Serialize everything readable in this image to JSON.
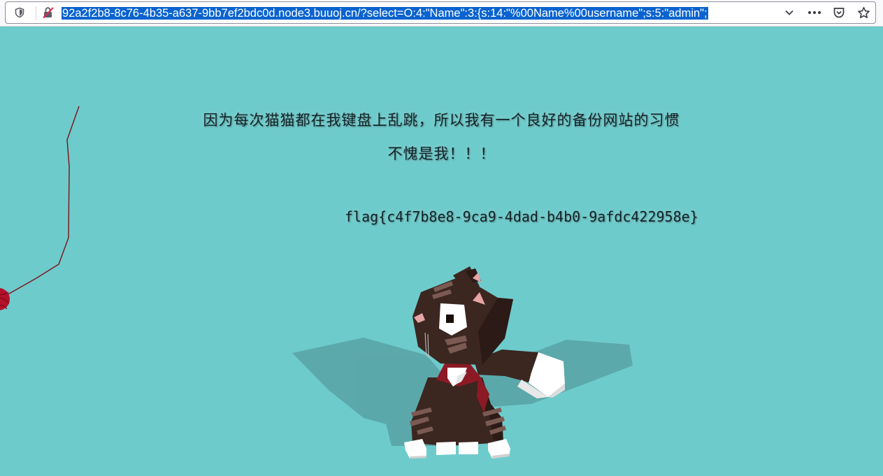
{
  "browser": {
    "url": "92a2f2b8-8c76-4b35-a637-9bb7ef2bdc0d.node3.buuoj.cn/?select=O:4:\"Name\":3:{s:14:\"%00Name%00username\";s:5:\"admin\";",
    "icons": [
      "shield-icon",
      "insecure-lock-icon",
      "chevron-down-icon",
      "more-icon",
      "pocket-icon",
      "bookmark-star-icon"
    ]
  },
  "page": {
    "message_line1": "因为每次猫猫都在我键盘上乱跳，所以我有一个良好的备份网站的习惯",
    "message_line2": "不愧是我！！！",
    "flag": "flag{c4f7b8e8-9ca9-4dad-b4b0-9afdc422958e}"
  },
  "colors": {
    "background": "#6ecbcb",
    "text": "#11242a",
    "url_selection": "#0a63cf",
    "cat_body": "#3b2620",
    "cat_white": "#ffffff",
    "bowtie": "#8b1a24",
    "yarn": "#b3122a"
  }
}
